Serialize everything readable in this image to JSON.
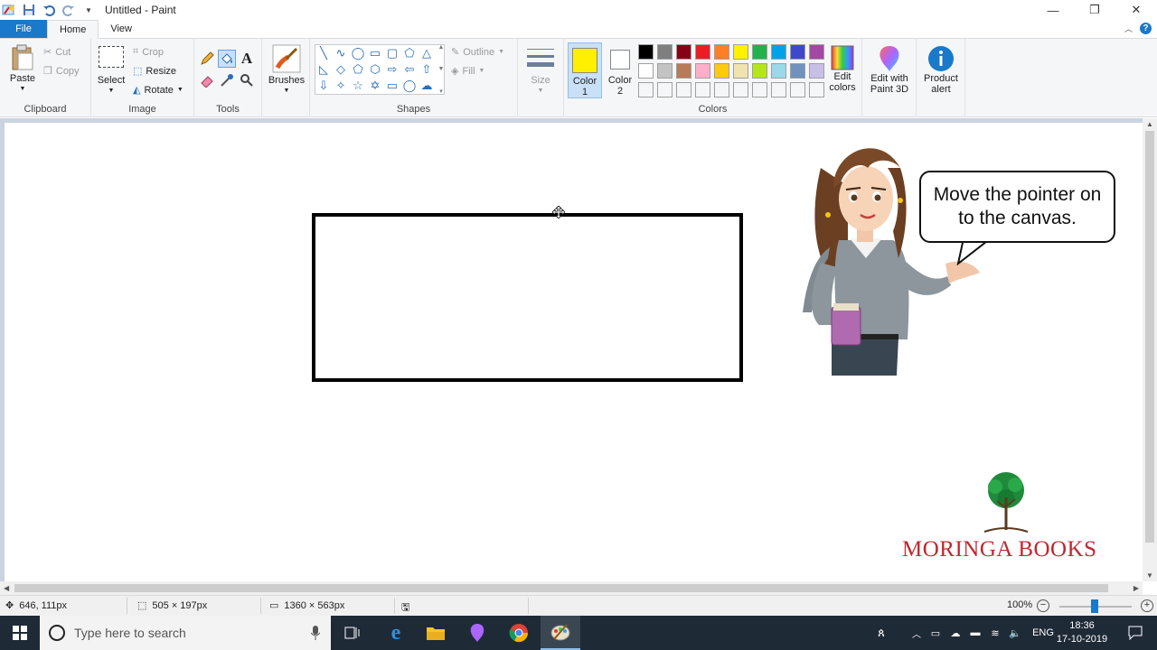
{
  "window": {
    "title": "Untitled - Paint",
    "controls": {
      "minimize": "—",
      "maximize": "❐",
      "close": "✕"
    }
  },
  "tabs": [
    {
      "label": "File"
    },
    {
      "label": "Home"
    },
    {
      "label": "View"
    }
  ],
  "ribbon": {
    "clipboard": {
      "label": "Clipboard",
      "paste": "Paste",
      "cut": "Cut",
      "copy": "Copy"
    },
    "image": {
      "label": "Image",
      "select": "Select",
      "crop": "Crop",
      "resize": "Resize",
      "rotate": "Rotate"
    },
    "tools": {
      "label": "Tools"
    },
    "brushes": {
      "label": "Brushes"
    },
    "shapes": {
      "label": "Shapes",
      "outline": "Outline",
      "fill": "Fill"
    },
    "size": {
      "label": "Size"
    },
    "colors": {
      "label": "Colors",
      "color1": {
        "line1": "Color",
        "line2": "1",
        "value": "#ffef00"
      },
      "color2": {
        "line1": "Color",
        "line2": "2",
        "value": "#ffffff"
      },
      "edit_colors": {
        "line1": "Edit",
        "line2": "colors"
      },
      "palette_row1": [
        "#000000",
        "#7f7f7f",
        "#880015",
        "#ed1c24",
        "#ff7f27",
        "#fff200",
        "#22b14c",
        "#00a2e8",
        "#3f48cc",
        "#a349a4"
      ],
      "palette_row2": [
        "#ffffff",
        "#c3c3c3",
        "#b97a57",
        "#ffaec9",
        "#ffc90e",
        "#efe4b0",
        "#b5e61d",
        "#99d9ea",
        "#7092be",
        "#c8bfe7"
      ],
      "palette_row3": [
        "#f5f6f7",
        "#f5f6f7",
        "#f5f6f7",
        "#f5f6f7",
        "#f5f6f7",
        "#f5f6f7",
        "#f5f6f7",
        "#f5f6f7",
        "#f5f6f7",
        "#f5f6f7"
      ]
    },
    "paint3d": {
      "line1": "Edit with",
      "line2": "Paint 3D"
    },
    "product_alert": {
      "line1": "Product",
      "line2": "alert"
    }
  },
  "canvas": {
    "speech": "Move the pointer on to the canvas.",
    "logo_text": "MORINGA BOOKS"
  },
  "status": {
    "cursor_pos": "646, 111px",
    "selection_size": "505 × 197px",
    "canvas_size": "1360 × 563px",
    "zoom": "100%"
  },
  "taskbar": {
    "search_placeholder": "Type here to search",
    "lang": "ENG",
    "time": "18:36",
    "date": "17-10-2019"
  }
}
